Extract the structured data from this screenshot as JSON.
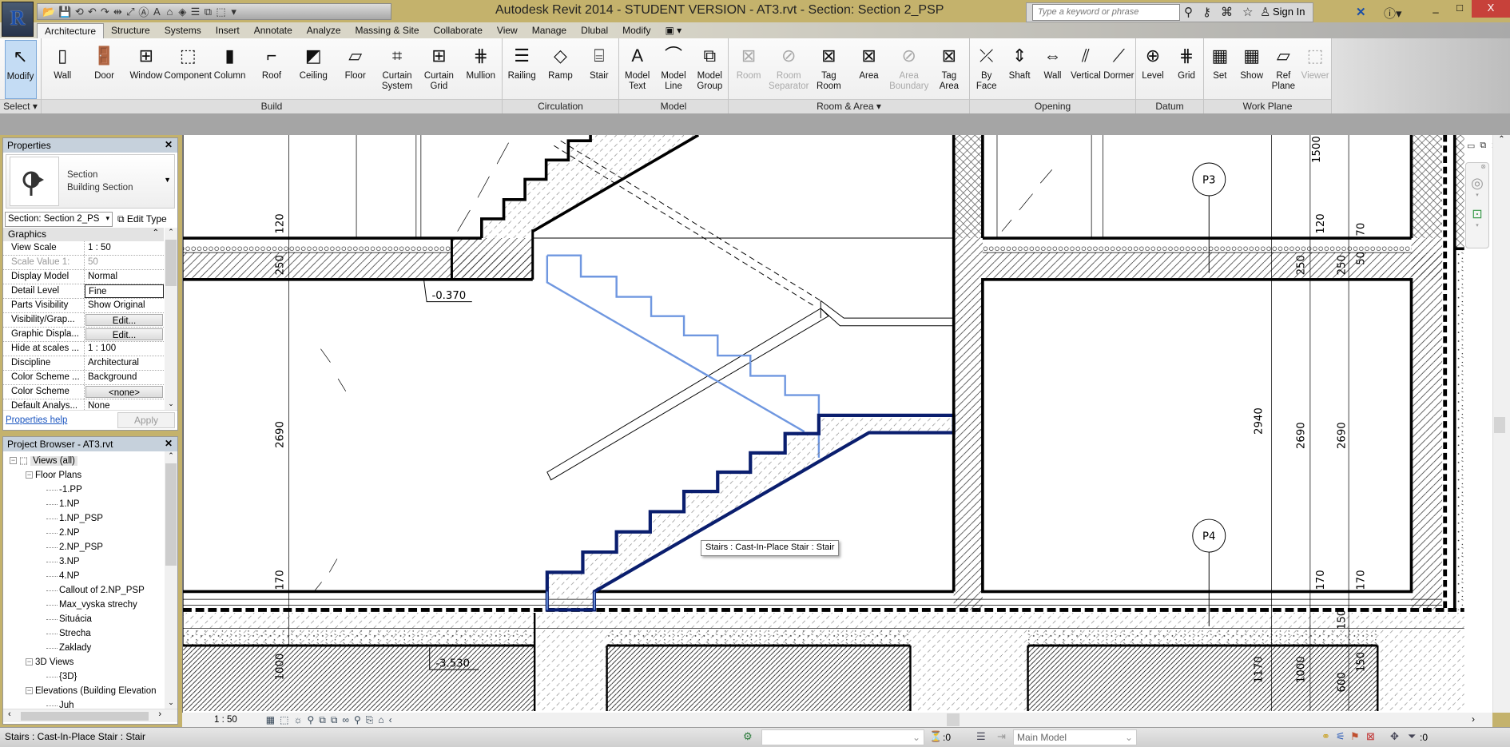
{
  "window": {
    "title": "Autodesk Revit 2014 - STUDENT VERSION -      AT3.rvt - Section: Section 2_PSP",
    "app_button": "R",
    "search_placeholder": "Type a keyword or phrase",
    "sign_in": "Sign In",
    "minimize": "_",
    "maximize": "□",
    "close": "X"
  },
  "quick_access": [
    "📂",
    "💾",
    "⟲",
    "↶",
    "↷",
    "⇹",
    "⤢",
    "Ⓐ",
    "A",
    "⌂",
    "◈",
    "☰",
    "⧉",
    "⬚",
    "▾"
  ],
  "tabs": [
    "Architecture",
    "Structure",
    "Systems",
    "Insert",
    "Annotate",
    "Analyze",
    "Massing & Site",
    "Collaborate",
    "View",
    "Manage",
    "Dlubal",
    "Modify",
    "▣ ▾"
  ],
  "active_tab": "Architecture",
  "ribbon": {
    "panels": [
      {
        "label": "Select ▾",
        "buttons": [
          {
            "label": "Modify",
            "icon": "↖"
          }
        ]
      },
      {
        "label": "Build",
        "buttons": [
          {
            "label": "Wall",
            "icon": "▯"
          },
          {
            "label": "Door",
            "icon": "🚪"
          },
          {
            "label": "Window",
            "icon": "⊞"
          },
          {
            "label": "Component",
            "icon": "⬚"
          },
          {
            "label": "Column",
            "icon": "▮"
          },
          {
            "label": "Roof",
            "icon": "⌐"
          },
          {
            "label": "Ceiling",
            "icon": "◩"
          },
          {
            "label": "Floor",
            "icon": "▱"
          },
          {
            "label": "Curtain System",
            "icon": "⌗"
          },
          {
            "label": "Curtain Grid",
            "icon": "⊞"
          },
          {
            "label": "Mullion",
            "icon": "⋕"
          }
        ]
      },
      {
        "label": "Circulation",
        "buttons": [
          {
            "label": "Railing",
            "icon": "☰"
          },
          {
            "label": "Ramp",
            "icon": "◇"
          },
          {
            "label": "Stair",
            "icon": "⌸"
          }
        ]
      },
      {
        "label": "Model",
        "buttons": [
          {
            "label": "Model Text",
            "icon": "A"
          },
          {
            "label": "Model Line",
            "icon": "⌒"
          },
          {
            "label": "Model Group",
            "icon": "⧉"
          }
        ]
      },
      {
        "label": "Room & Area ▾",
        "buttons": [
          {
            "label": "Room",
            "icon": "⊠"
          },
          {
            "label": "Room Separator",
            "icon": "⊘"
          },
          {
            "label": "Tag Room",
            "icon": "⊠"
          },
          {
            "label": "Area",
            "icon": "⊠"
          },
          {
            "label": "Area Boundary",
            "icon": "⊘"
          },
          {
            "label": "Tag Area",
            "icon": "⊠"
          }
        ]
      },
      {
        "label": "Opening",
        "buttons": [
          {
            "label": "By Face",
            "icon": "⤫"
          },
          {
            "label": "Shaft",
            "icon": "⇕"
          },
          {
            "label": "Wall",
            "icon": "⇔"
          },
          {
            "label": "Vertical",
            "icon": "⫽"
          },
          {
            "label": "Dormer",
            "icon": "⟋"
          }
        ]
      },
      {
        "label": "Datum",
        "buttons": [
          {
            "label": "Level",
            "icon": "⊕"
          },
          {
            "label": "Grid",
            "icon": "⋕"
          }
        ]
      },
      {
        "label": "Work Plane",
        "buttons": [
          {
            "label": "Set",
            "icon": "▦"
          },
          {
            "label": "Show",
            "icon": "▦"
          },
          {
            "label": "Ref Plane",
            "icon": "▱"
          },
          {
            "label": "Viewer",
            "icon": "⬚"
          }
        ]
      }
    ]
  },
  "properties": {
    "title": "Properties",
    "type_line1": "Section",
    "type_line2": "Building Section",
    "instance": "Section: Section 2_PS",
    "edit_type": "Edit Type",
    "group": "Graphics",
    "rows": [
      {
        "k": "View Scale",
        "v": "1 : 50"
      },
      {
        "k": "Scale Value    1:",
        "v": "50"
      },
      {
        "k": "Display Model",
        "v": "Normal"
      },
      {
        "k": "Detail Level",
        "v": "Fine"
      },
      {
        "k": "Parts Visibility",
        "v": "Show Original"
      },
      {
        "k": "Visibility/Grap...",
        "v": "Edit..."
      },
      {
        "k": "Graphic Displa...",
        "v": "Edit..."
      },
      {
        "k": "Hide at scales ...",
        "v": "1 : 100"
      },
      {
        "k": "Discipline",
        "v": "Architectural"
      },
      {
        "k": "Color Scheme ...",
        "v": "Background"
      },
      {
        "k": "Color Scheme",
        "v": "<none>"
      },
      {
        "k": "Default Analys...",
        "v": "None"
      }
    ],
    "help": "Properties help",
    "apply": "Apply"
  },
  "browser": {
    "title": "Project Browser - AT3.rvt",
    "items": [
      {
        "label": "Views (all)",
        "level": 0
      },
      {
        "label": "Floor Plans",
        "level": 1
      },
      {
        "label": "-1.PP",
        "level": 2
      },
      {
        "label": "1.NP",
        "level": 2
      },
      {
        "label": "1.NP_PSP",
        "level": 2
      },
      {
        "label": "2.NP",
        "level": 2
      },
      {
        "label": "2.NP_PSP",
        "level": 2
      },
      {
        "label": "3.NP",
        "level": 2
      },
      {
        "label": "4.NP",
        "level": 2
      },
      {
        "label": "Callout of 2.NP_PSP",
        "level": 2
      },
      {
        "label": "Max_vyska strechy",
        "level": 2
      },
      {
        "label": "Situácia",
        "level": 2
      },
      {
        "label": "Strecha",
        "level": 2
      },
      {
        "label": "Zaklady",
        "level": 2
      },
      {
        "label": "3D Views",
        "level": 1
      },
      {
        "label": "{3D}",
        "level": 2
      },
      {
        "label": "Elevations (Building Elevation",
        "level": 1
      },
      {
        "label": "Juh",
        "level": 2
      }
    ]
  },
  "drawing": {
    "dims_left": {
      "d120": "120",
      "d250": "250",
      "d2690": "2690",
      "d170": "170",
      "d1000": "1000"
    },
    "dims_right": {
      "d1500": "1500",
      "d120": "120",
      "d70": "70",
      "d250a": "250",
      "d250b": "250",
      "d50": "50",
      "d2940": "2940",
      "d2690a": "2690",
      "d2690b": "2690",
      "d170a": "170",
      "d170b": "170",
      "d150a": "150",
      "d1170": "1170",
      "d1000": "1000",
      "d150b": "150",
      "d600": "600"
    },
    "level_upper": "-0.370",
    "level_lower": "-3.530",
    "grid_p3": "P3",
    "grid_p4": "P4",
    "tooltip": "Stairs : Cast-In-Place Stair : Stair",
    "colors": {
      "selected": "#0a1e6e",
      "projection": "#6f97e0"
    }
  },
  "view_control": {
    "scale": "1 : 50",
    "icons": [
      "▦",
      "⬚",
      "☼",
      "⚲",
      "⧉",
      "⧉",
      "∞",
      "⚲",
      "⎘",
      "⌂",
      "‹"
    ]
  },
  "status": {
    "text": "Stairs : Cast-In-Place Stair : Stair",
    "filter_count": ":0",
    "model": "Main Model",
    "filter_count2": ":0"
  }
}
